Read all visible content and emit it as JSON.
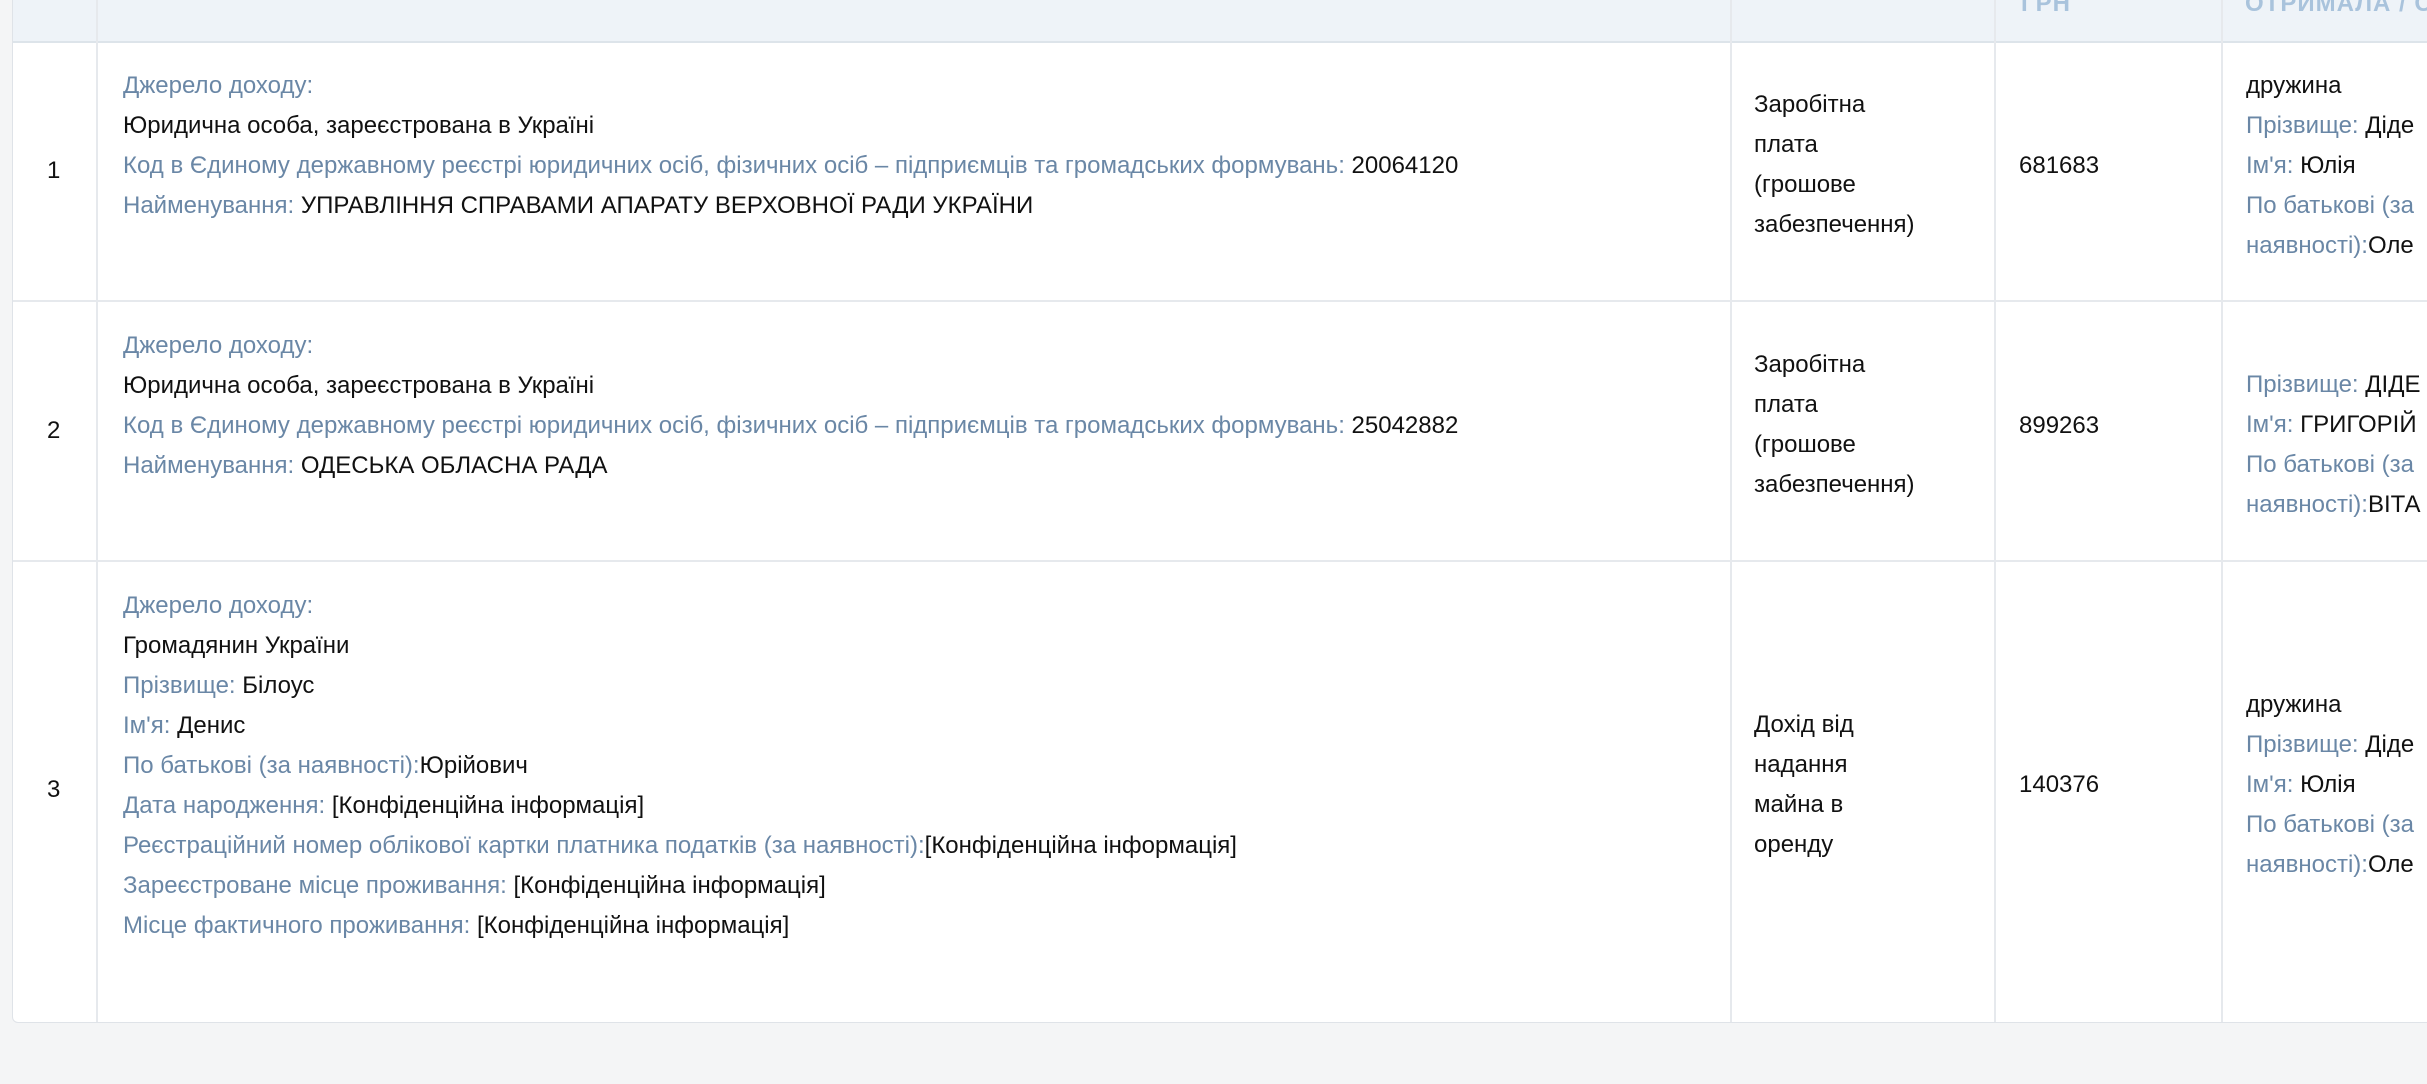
{
  "header": {
    "col_amount_label": "ГРН",
    "col_recipient_label": "ОТРИМАЛА / ОТРИМАВ"
  },
  "labels": {
    "source": "Джерело доходу:",
    "code": "Код в Єдиному державному реєстрі юридичних осіб, фізичних осіб – підприємців та громадських формувань:",
    "name": "Найменування:",
    "surname": "Прізвище:",
    "first_name": "Ім'я:",
    "patronymic_1": "По батькові (за",
    "patronymic_2": "наявності):",
    "patronymic_full": "По батькові (за наявності):",
    "dob": "Дата народження:",
    "tax_id": "Реєстраційний номер облікової картки платника податків (за наявності):",
    "reg_address": "Зареєстроване місце проживання:",
    "actual_address": "Місце фактичного проживання:"
  },
  "rows": [
    {
      "index": "1",
      "source_type": "Юридична особа, зареєстрована в Україні",
      "code": "20064120",
      "name": "УПРАВЛІННЯ СПРАВАМИ АПАРАТУ ВЕРХОВНОЇ РАДИ УКРАЇНИ",
      "income_type": [
        "Заробітна",
        "плата",
        "(грошове",
        "забезпечення)"
      ],
      "amount": "681683",
      "recipient": {
        "relation": "дружина",
        "surname": "Діде",
        "first_name": "Юлія",
        "patronymic_1_tail": "",
        "patronymic": "Оле"
      }
    },
    {
      "index": "2",
      "source_type": "Юридична особа, зареєстрована в Україні",
      "code": "25042882",
      "name": "ОДЕСЬКА ОБЛАСНА РАДА",
      "income_type": [
        "Заробітна",
        "плата",
        "(грошове",
        "забезпечення)"
      ],
      "amount": "899263",
      "recipient": {
        "relation": "",
        "surname": "ДІДЕ",
        "first_name": "ГРИГОРІЙ",
        "patronymic": "ВІТА"
      }
    },
    {
      "index": "3",
      "source_type": "Громадянин України",
      "surname": "Білоус",
      "first_name": "Денис",
      "patronymic": "Юрійович",
      "dob": "[Конфіденційна інформація]",
      "tax_id": "[Конфіденційна інформація]",
      "reg_address": "[Конфіденційна інформація]",
      "actual_address": "[Конфіденційна інформація]",
      "income_type": [
        "Дохід від",
        "надання",
        "майна в",
        "оренду"
      ],
      "amount": "140376",
      "recipient": {
        "relation": "дружина",
        "surname": "Діде",
        "first_name": "Юлія",
        "patronymic": "Оле"
      }
    }
  ]
}
